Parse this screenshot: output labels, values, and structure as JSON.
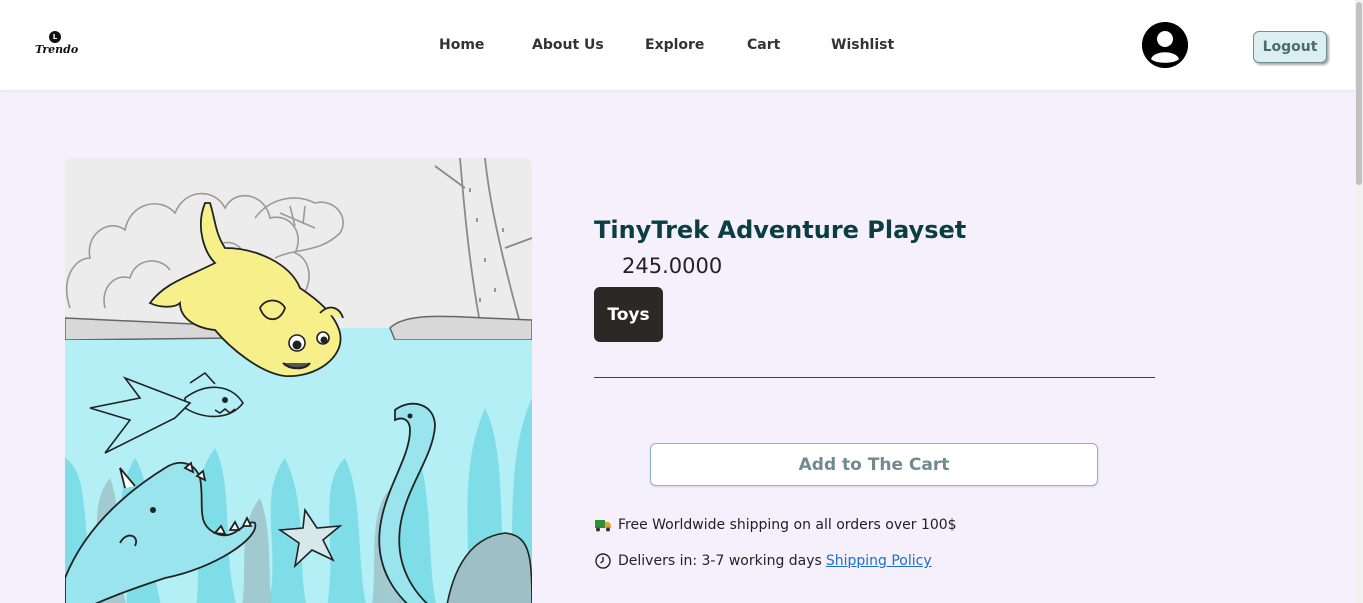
{
  "brand": {
    "name": "Trendo",
    "logo_mark": "L"
  },
  "nav": {
    "links": [
      {
        "label": "Home"
      },
      {
        "label": "About Us"
      },
      {
        "label": "Explore"
      },
      {
        "label": "Cart"
      },
      {
        "label": "Wishlist"
      }
    ],
    "avatar_icon": "user-circle-icon",
    "logout_label": "Logout"
  },
  "product": {
    "title": "TinyTrek Adventure Playset",
    "price": "245.0000",
    "category": "Toys",
    "add_to_cart_label": "Add to The Cart",
    "image_icon": "illustration-cat-diving-sea-creatures"
  },
  "info": {
    "shipping_text": "Free Worldwide shipping on all orders over 100$",
    "shipping_icon": "truck-icon",
    "delivery_text": "Delivers in: 3-7 working days",
    "delivery_icon": "clock-icon",
    "shipping_policy_link": "Shipping Policy"
  },
  "colors": {
    "page_bg": "#f6effc",
    "title": "#0a3d44",
    "badge_bg": "#2b2926",
    "logout_bg": "#dbeff1",
    "link": "#1a6fd1"
  }
}
